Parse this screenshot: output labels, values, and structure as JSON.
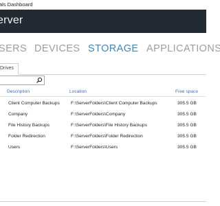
{
  "window": {
    "title": "als Dashboard"
  },
  "header": {
    "product": "erver"
  },
  "nav": {
    "tabs": [
      {
        "label": "SERS",
        "active": false
      },
      {
        "label": "DEVICES",
        "active": false
      },
      {
        "label": "STORAGE",
        "active": true
      },
      {
        "label": "APPLICATIONS",
        "active": false
      }
    ]
  },
  "subtabs": [
    {
      "label": "Drives"
    }
  ],
  "search": {
    "value": "",
    "placeholder": ""
  },
  "table": {
    "columns": [
      "Description",
      "Location",
      "Free space"
    ],
    "rows": [
      {
        "description": "Client Computer Backups",
        "location": "F:\\ServerFolders\\Client Computer Backups",
        "free": "305.5 GB"
      },
      {
        "description": "Company",
        "location": "F:\\ServerFolders\\Company",
        "free": "305.5 GB"
      },
      {
        "description": "File History Backups",
        "location": "F:\\ServerFolders\\File History Backups",
        "free": "305.5 GB"
      },
      {
        "description": "Folder Redirection",
        "location": "F:\\ServerFolders\\Folder Redirection",
        "free": "305.5 GB"
      },
      {
        "description": "Users",
        "location": "F:\\ServerFolders\\Users",
        "free": "305.5 GB"
      }
    ]
  },
  "colors": {
    "header_bg": "#222a33",
    "active_tab": "#3a87b8",
    "inactive_tab": "#9a9ea3",
    "column_header": "#3a6fb0"
  },
  "icons": {
    "search": "magnifier-icon"
  }
}
